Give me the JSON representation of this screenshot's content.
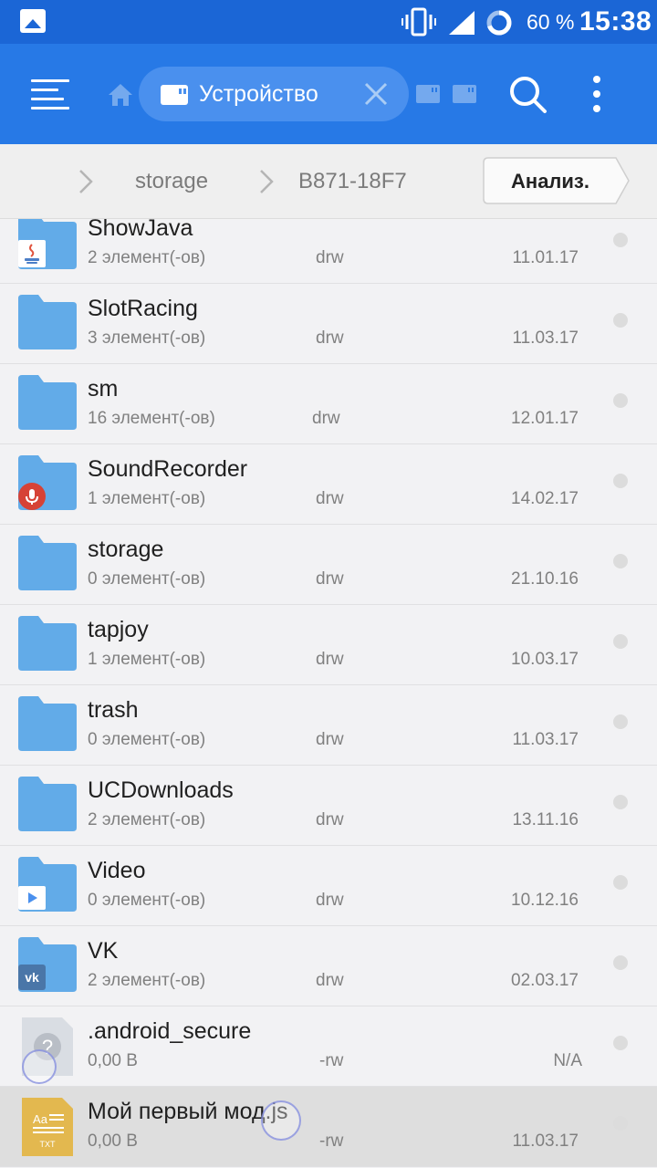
{
  "status_bar": {
    "battery_percent": "60 %",
    "time": "15:38",
    "icons": [
      "image-notification-icon",
      "vibrate-icon",
      "signal-icon",
      "battery-ring-icon"
    ]
  },
  "toolbar": {
    "location_chip_label": "Устройство",
    "icons": [
      "menu-icon",
      "home-icon",
      "sd-card-icon",
      "close-icon",
      "search-icon",
      "more-vert-icon"
    ]
  },
  "path": {
    "crumbs": [
      "storage",
      "B871-18F7"
    ],
    "analyze_label": "Анализ."
  },
  "files": [
    {
      "name": "ShowJava",
      "count": "2 элемент(-ов)",
      "perm": "drw",
      "date": "11.01.17",
      "kind": "folder",
      "badge": "java"
    },
    {
      "name": "SlotRacing",
      "count": "3 элемент(-ов)",
      "perm": "drw",
      "date": "11.03.17",
      "kind": "folder",
      "badge": ""
    },
    {
      "name": "sm",
      "count": "16 элемент(-ов)",
      "perm": "drw",
      "date": "12.01.17",
      "kind": "folder",
      "badge": ""
    },
    {
      "name": "SoundRecorder",
      "count": "1 элемент(-ов)",
      "perm": "drw",
      "date": "14.02.17",
      "kind": "folder",
      "badge": "mic"
    },
    {
      "name": "storage",
      "count": "0 элемент(-ов)",
      "perm": "drw",
      "date": "21.10.16",
      "kind": "folder",
      "badge": ""
    },
    {
      "name": "tapjoy",
      "count": "1 элемент(-ов)",
      "perm": "drw",
      "date": "10.03.17",
      "kind": "folder",
      "badge": ""
    },
    {
      "name": "trash",
      "count": "0 элемент(-ов)",
      "perm": "drw",
      "date": "11.03.17",
      "kind": "folder",
      "badge": ""
    },
    {
      "name": "UCDownloads",
      "count": "2 элемент(-ов)",
      "perm": "drw",
      "date": "13.11.16",
      "kind": "folder",
      "badge": ""
    },
    {
      "name": "Video",
      "count": "0 элемент(-ов)",
      "perm": "drw",
      "date": "10.12.16",
      "kind": "folder",
      "badge": "video"
    },
    {
      "name": "VK",
      "count": "2 элемент(-ов)",
      "perm": "drw",
      "date": "02.03.17",
      "kind": "folder",
      "badge": "vk"
    },
    {
      "name": ".android_secure",
      "count": "0,00 B",
      "perm": "-rw",
      "date": "N/A",
      "kind": "unknown",
      "badge": ""
    },
    {
      "name": "Мой первый мод.js",
      "count": "0,00 B",
      "perm": "-rw",
      "date": "11.03.17",
      "kind": "txt",
      "badge": ""
    }
  ],
  "file_icon_texts": {
    "txt_top": "Aa",
    "txt_bottom": "TXT",
    "unknown": "?",
    "vk": "vk"
  },
  "colors": {
    "toolbar": "#2779e6",
    "status_bar": "#1b66d6",
    "folder": "#62abe8",
    "txt_file": "#e3b84f",
    "mic_badge": "#d64236"
  }
}
